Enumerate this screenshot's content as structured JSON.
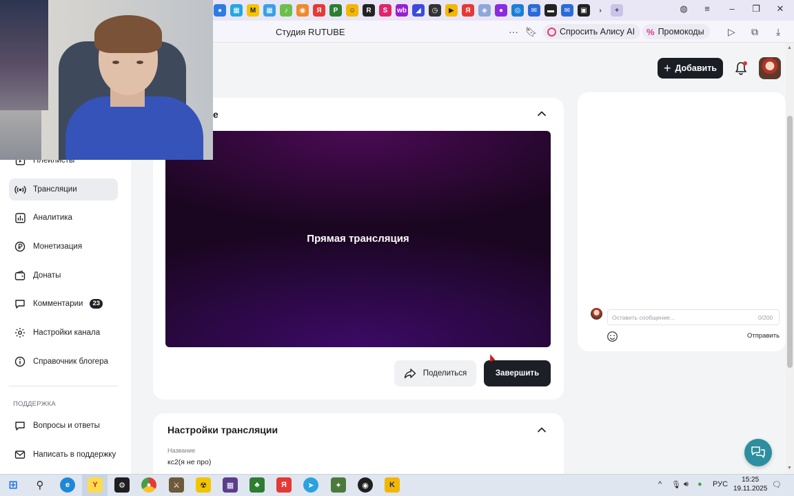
{
  "browser": {
    "site_title": "Студия RUTUBE",
    "alice_label": "Спросить Алису AI",
    "promo_label": "Промокоды",
    "window_controls": [
      "minimize-icon",
      "maximize-icon",
      "close-icon"
    ]
  },
  "header": {
    "add_label": "Добавить"
  },
  "sidebar": {
    "items": [
      {
        "label": "Плейлисты",
        "icon": "playlist-icon"
      },
      {
        "label": "Трансляции",
        "icon": "broadcast-icon",
        "active": true
      },
      {
        "label": "Аналитика",
        "icon": "analytics-icon"
      },
      {
        "label": "Монетизация",
        "icon": "monetization-icon"
      },
      {
        "label": "Донаты",
        "icon": "donate-icon"
      },
      {
        "label": "Комментарии",
        "icon": "comments-icon",
        "badge": "23"
      },
      {
        "label": "Настройки канала",
        "icon": "channel-settings-icon"
      },
      {
        "label": "Справочник блогера",
        "icon": "info-icon"
      }
    ],
    "support_heading": "ПОДДЕРЖКА",
    "support_items": [
      {
        "label": "Вопросы и ответы",
        "icon": "faq-icon"
      },
      {
        "label": "Написать в поддержку",
        "icon": "mail-icon"
      }
    ]
  },
  "stream": {
    "partial_title": "е",
    "player_text": "Прямая трансляция",
    "share_label": "Поделиться",
    "finish_label": "Завершить"
  },
  "settings": {
    "title": "Настройки трансляции",
    "name_label": "Название",
    "name_value": "кс2(я не про)"
  },
  "chat": {
    "placeholder": "Оставить сообщение...",
    "counter": "0/200",
    "send_label": "Отправить"
  },
  "taskbar": {
    "language": "РУС",
    "time": "15:25",
    "date": "19.11.2025"
  },
  "colors": {
    "accent_dark": "#1c1f26",
    "player_purple": "#3c0a66",
    "badge_bg": "#1f2128",
    "notification_dot": "#e5322f",
    "support_fab": "#2c8e9e"
  }
}
